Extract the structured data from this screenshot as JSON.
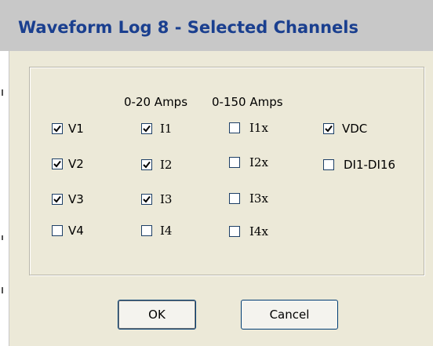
{
  "window": {
    "title": "Waveform Log 8 - Selected Channels"
  },
  "group": {
    "headers": {
      "amps_20": "0-20 Amps",
      "amps_150": "0-150 Amps"
    },
    "channels": {
      "v1": {
        "label": "V1",
        "checked": true
      },
      "v2": {
        "label": "V2",
        "checked": true
      },
      "v3": {
        "label": "V3",
        "checked": true
      },
      "v4": {
        "label": "V4",
        "checked": false
      },
      "i1": {
        "label": "I1",
        "checked": true
      },
      "i2": {
        "label": "I2",
        "checked": true
      },
      "i3": {
        "label": "I3",
        "checked": true
      },
      "i4": {
        "label": "I4",
        "checked": false
      },
      "i1x": {
        "label": "I1x",
        "checked": false
      },
      "i2x": {
        "label": "I2x",
        "checked": false
      },
      "i3x": {
        "label": "I3x",
        "checked": false
      },
      "i4x": {
        "label": "I4x",
        "checked": false
      },
      "vdc": {
        "label": "VDC",
        "checked": true
      },
      "di": {
        "label": "DI1-DI16",
        "checked": false
      }
    }
  },
  "buttons": {
    "ok": "OK",
    "cancel": "Cancel"
  },
  "colors": {
    "title_text": "#1a3f8f",
    "checkbox_border": "#1d3f66",
    "button_border": "#003c74"
  }
}
